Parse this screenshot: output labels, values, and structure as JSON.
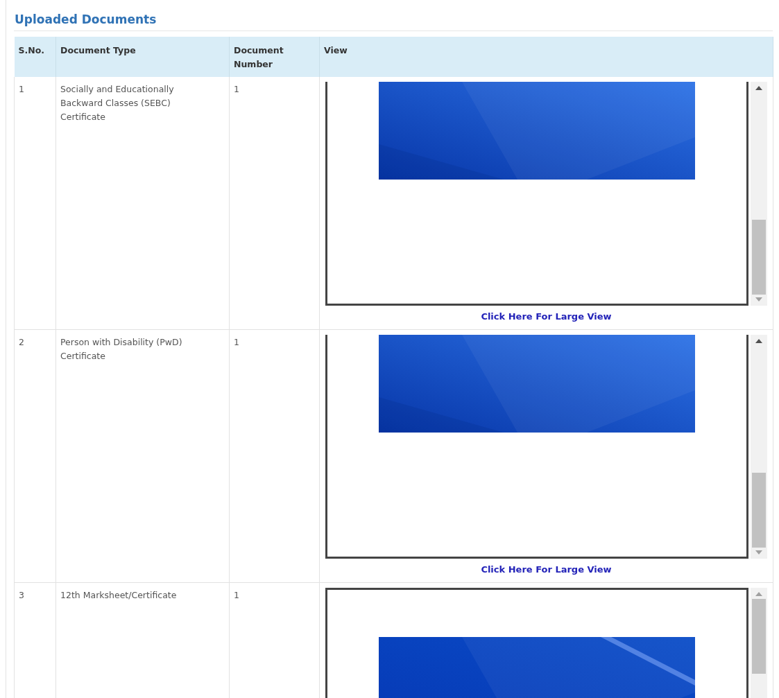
{
  "heading": "Uploaded Documents",
  "table": {
    "columns": [
      "S.No.",
      "Document Type",
      "Document Number",
      "View"
    ],
    "rows": [
      {
        "sno": "1",
        "document_type": "Socially and Educationally Backward Classes (SEBC) Certificate",
        "document_number": "1",
        "viewer": {
          "scrolled": true
        },
        "view_link": "Click Here For Large View"
      },
      {
        "sno": "2",
        "document_type": "Person with Disability (PwD) Certificate",
        "document_number": "1",
        "viewer": {
          "scrolled": true
        },
        "view_link": "Click Here For Large View"
      },
      {
        "sno": "3",
        "document_type": "12th Marksheet/Certificate",
        "document_number": "1",
        "viewer": {
          "scrolled": false
        }
      }
    ]
  }
}
